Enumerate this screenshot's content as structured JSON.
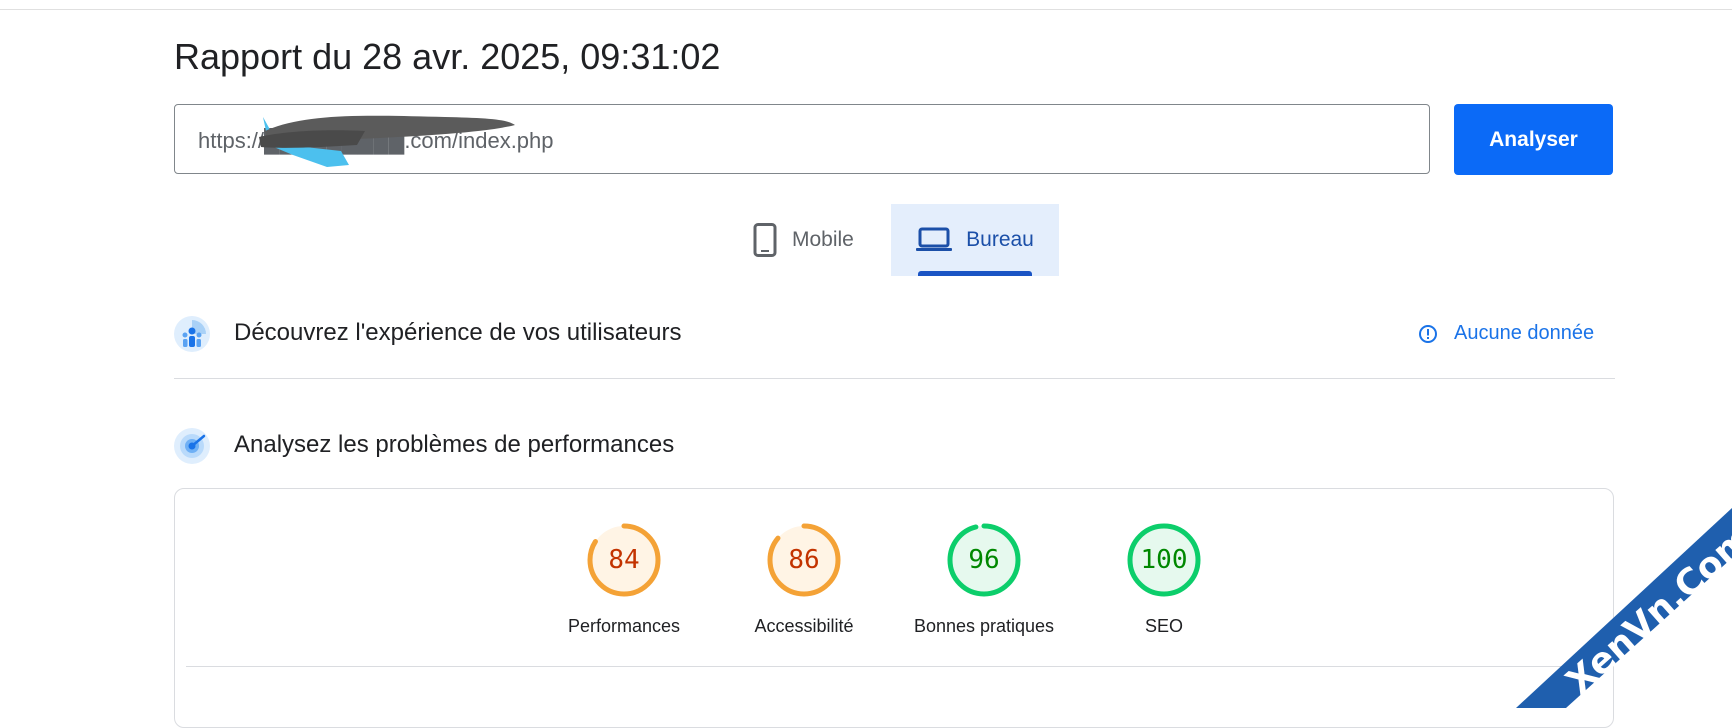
{
  "report": {
    "title": "Rapport du 28 avr. 2025, 09:31:02"
  },
  "search": {
    "url_value": "https://█████████.com/index.php",
    "analyze_label": "Analyser"
  },
  "device_tabs": [
    {
      "label": "Mobile",
      "icon": "smartphone-icon",
      "selected": false
    },
    {
      "label": "Bureau",
      "icon": "laptop-icon",
      "selected": true
    }
  ],
  "field_data": {
    "title": "Découvrez l'expérience de vos utilisateurs",
    "status": "Aucune donnée",
    "status_icon": "info-icon"
  },
  "lab_data": {
    "title": "Analysez les problèmes de performances"
  },
  "scores": [
    {
      "label": "Performances",
      "value": 84,
      "color": "#f4a236",
      "text_color": "#c33300",
      "fill": "#fff4e5"
    },
    {
      "label": "Accessibilité",
      "value": 86,
      "color": "#f4a236",
      "text_color": "#c33300",
      "fill": "#fff4e5"
    },
    {
      "label": "Bonnes pratiques",
      "value": 96,
      "color": "#0cce6b",
      "text_color": "#008800",
      "fill": "#e6f9ee"
    },
    {
      "label": "SEO",
      "value": 100,
      "color": "#0cce6b",
      "text_color": "#008800",
      "fill": "#e6f9ee"
    }
  ],
  "colors": {
    "accent": "#0b6af7",
    "tab_selected_bg": "#e4eefc",
    "link": "#1a73e8"
  },
  "watermark": {
    "text": "XenVn.Com"
  }
}
